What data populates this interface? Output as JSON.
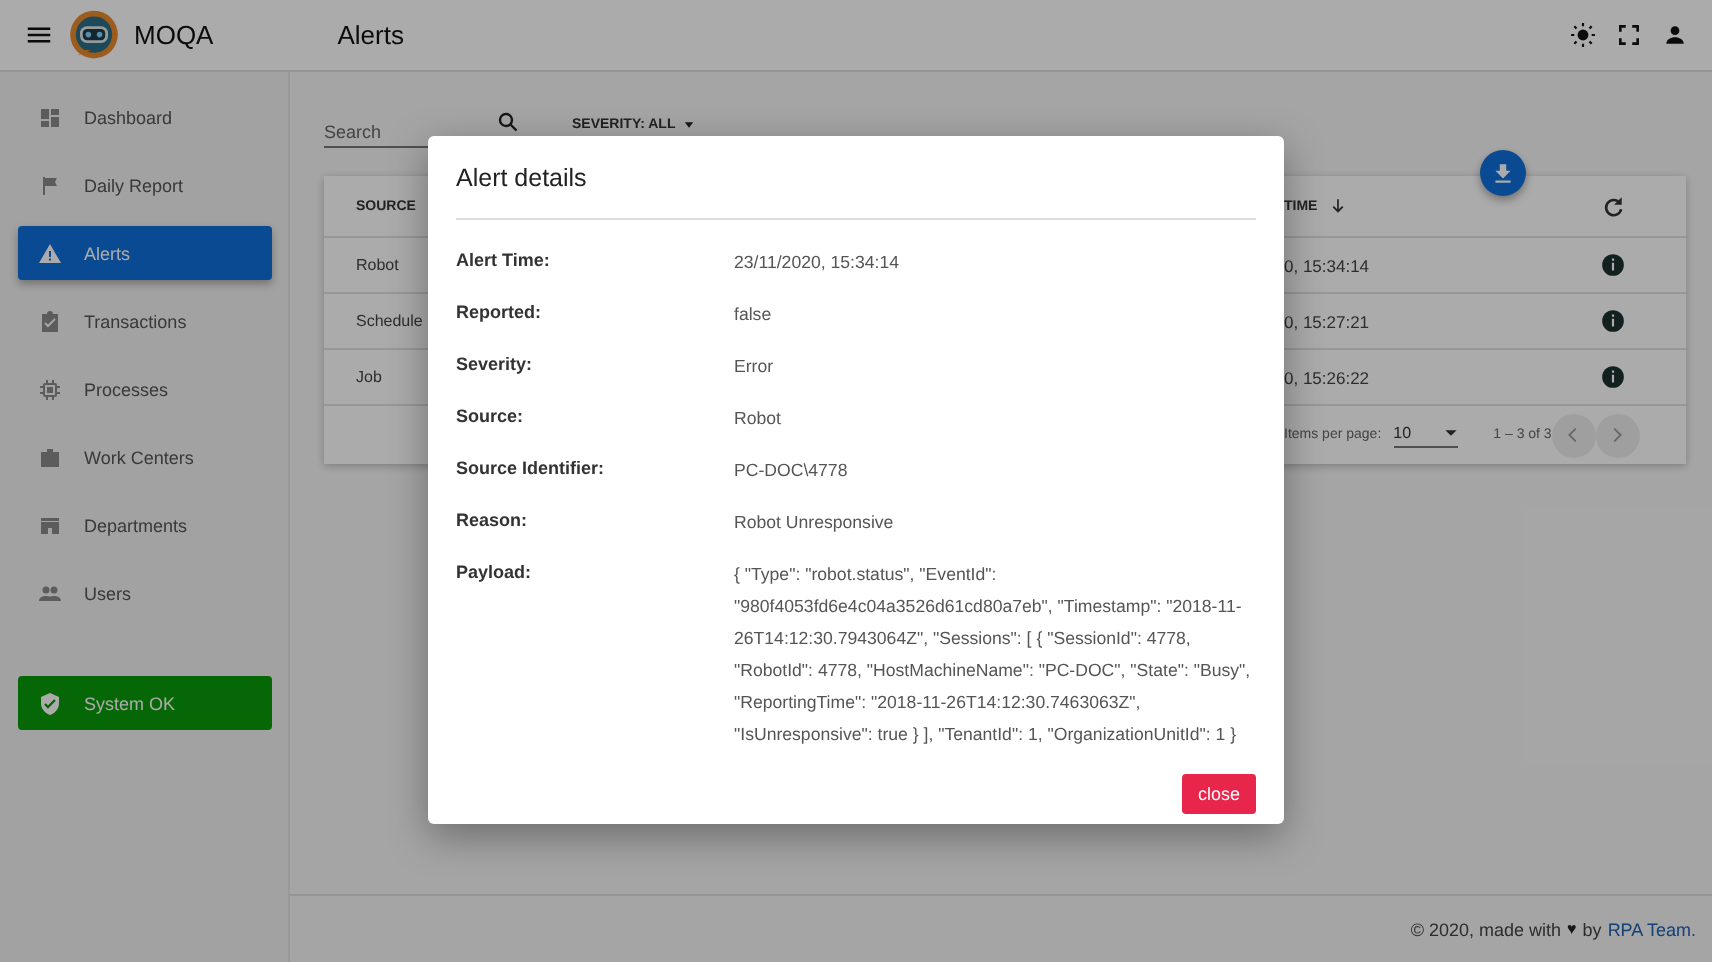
{
  "app": {
    "title": "MOQA"
  },
  "page_title": "Alerts",
  "sidebar": {
    "items": [
      {
        "label": "Dashboard",
        "kind": "dashboard",
        "selected": false
      },
      {
        "label": "Daily Report",
        "kind": "flag",
        "selected": false
      },
      {
        "label": "Alerts",
        "kind": "warning",
        "selected": true
      },
      {
        "label": "Transactions",
        "kind": "clipboard",
        "selected": false
      },
      {
        "label": "Processes",
        "kind": "chip",
        "selected": false
      },
      {
        "label": "Work Centers",
        "kind": "briefcase",
        "selected": false
      },
      {
        "label": "Departments",
        "kind": "store",
        "selected": false
      },
      {
        "label": "Users",
        "kind": "people",
        "selected": false
      }
    ]
  },
  "system_status": {
    "label": "System OK",
    "ok": true
  },
  "filters": {
    "search": {
      "placeholder": "Search"
    },
    "severity": "SEVERITY: ALL"
  },
  "table": {
    "columns": [
      "SOURCE",
      "TIME"
    ],
    "rows": [
      {
        "source": "Robot",
        "time": "0, 15:34:14"
      },
      {
        "source": "Schedule",
        "time": "0, 15:27:21"
      },
      {
        "source": "Job",
        "time": "0, 15:26:22"
      }
    ],
    "paginator": {
      "label": "Items per page:",
      "page_size": "10",
      "range": "1 – 3 of 3"
    }
  },
  "dialog": {
    "title": "Alert details",
    "fields": [
      {
        "label": "Alert Time:",
        "value": "23/11/2020, 15:34:14"
      },
      {
        "label": "Reported:",
        "value": "false"
      },
      {
        "label": "Severity:",
        "value": "Error"
      },
      {
        "label": "Source:",
        "value": "Robot"
      },
      {
        "label": "Source Identifier:",
        "value": "PC-DOC\\4778"
      },
      {
        "label": "Reason:",
        "value": "Robot Unresponsive"
      },
      {
        "label": "Payload:",
        "value": "{ \"Type\": \"robot.status\", \"EventId\": \"980f4053fd6e4c04a3526d61cd80a7eb\", \"Timestamp\": \"2018-11-26T14:12:30.7943064Z\", \"Sessions\": [ { \"SessionId\": 4778, \"RobotId\": 4778, \"HostMachineName\": \"PC-DOC\", \"State\": \"Busy\", \"ReportingTime\": \"2018-11-26T14:12:30.7463063Z\", \"IsUnresponsive\": true } ], \"TenantId\": 1, \"OrganizationUnitId\": 1 }"
      }
    ],
    "button": "close"
  },
  "footer": {
    "text": "© 2020, made with",
    "heart": "♥",
    "by": "by",
    "link": "RPA Team."
  }
}
